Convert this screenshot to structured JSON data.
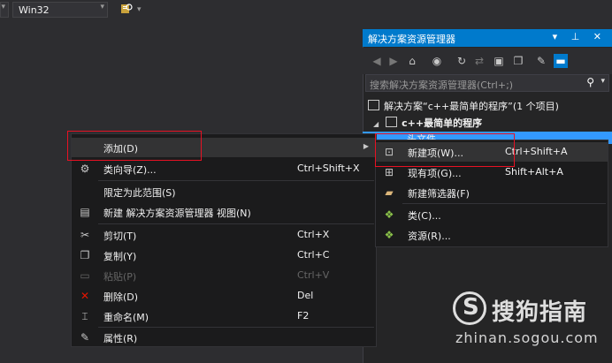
{
  "toolbar": {
    "platform": "Win32"
  },
  "solution_explorer": {
    "title": "解决方案资源管理器",
    "title_buttons": "▾ ⊥ ✕",
    "search_placeholder": "搜索解决方案资源管理器(Ctrl+;)",
    "tree": {
      "solution": "解决方案“c++最简单的程序”(1 个项目)",
      "project": "c++最简单的程序",
      "selected_item": "头文件"
    }
  },
  "context_menu": {
    "items": [
      {
        "label": "添加(D)",
        "shortcut": "",
        "icon": "none"
      },
      {
        "label": "类向导(Z)...",
        "shortcut": "Ctrl+Shift+X",
        "icon": "class-wizard-icon"
      },
      {
        "label": "限定为此范围(S)",
        "shortcut": "",
        "icon": "none"
      },
      {
        "label": "新建 解决方案资源管理器 视图(N)",
        "shortcut": "",
        "icon": "new-view-icon"
      },
      {
        "label": "剪切(T)",
        "shortcut": "Ctrl+X",
        "icon": "cut-icon"
      },
      {
        "label": "复制(Y)",
        "shortcut": "Ctrl+C",
        "icon": "copy-icon"
      },
      {
        "label": "粘贴(P)",
        "shortcut": "Ctrl+V",
        "icon": "paste-icon"
      },
      {
        "label": "删除(D)",
        "shortcut": "Del",
        "icon": "delete-icon"
      },
      {
        "label": "重命名(M)",
        "shortcut": "F2",
        "icon": "rename-icon"
      },
      {
        "label": "属性(R)",
        "shortcut": "",
        "icon": "properties-icon"
      }
    ]
  },
  "submenu": {
    "items": [
      {
        "label": "新建项(W)...",
        "shortcut": "Ctrl+Shift+A",
        "icon": "new-item-icon"
      },
      {
        "label": "现有项(G)...",
        "shortcut": "Shift+Alt+A",
        "icon": "existing-item-icon"
      },
      {
        "label": "新建筛选器(F)",
        "shortcut": "",
        "icon": "folder-icon"
      },
      {
        "label": "类(C)...",
        "shortcut": "",
        "icon": "class-icon"
      },
      {
        "label": "资源(R)...",
        "shortcut": "",
        "icon": "resource-icon"
      }
    ]
  },
  "watermark": {
    "brand": "搜狗指南",
    "url": "zhinan.sogou.com"
  },
  "colors": {
    "accent": "#007acc",
    "selection": "#3399ff",
    "highlight_box": "#e81123",
    "menu_bg": "#1b1b1c"
  }
}
